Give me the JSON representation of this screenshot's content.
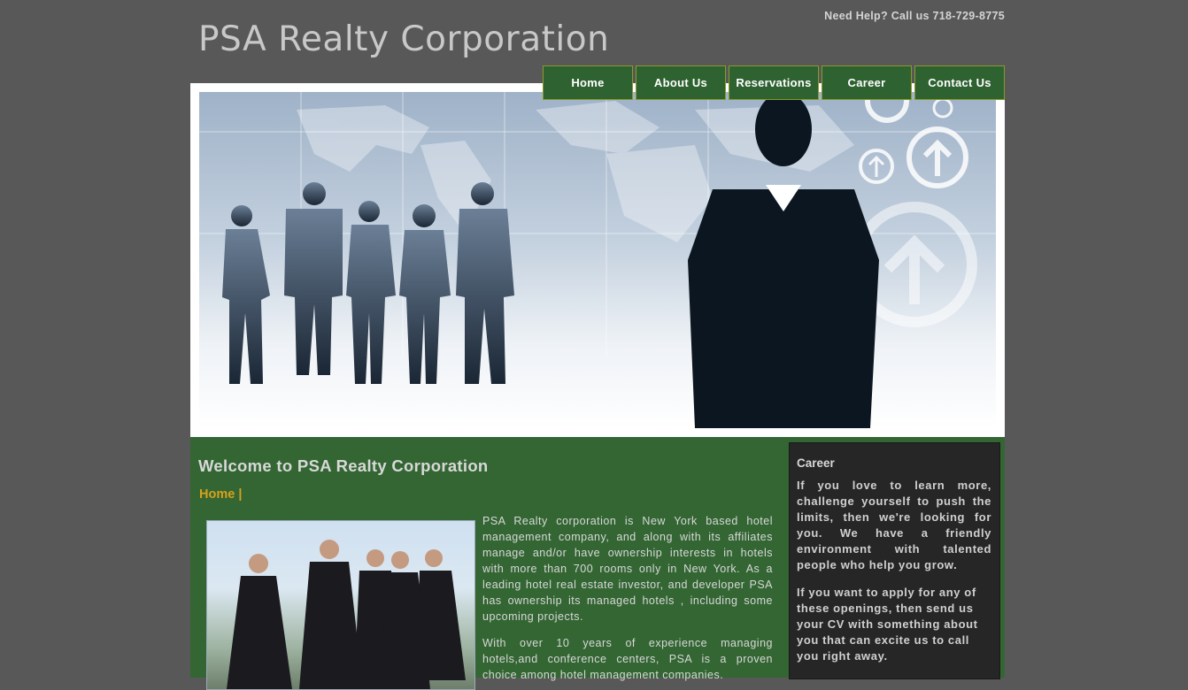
{
  "header": {
    "site_title": "PSA Realty Corporation",
    "help_text": "Need Help? Call us 718-729-8775"
  },
  "nav": {
    "items": [
      {
        "label": "Home"
      },
      {
        "label": "About Us"
      },
      {
        "label": "Reservations"
      },
      {
        "label": "Career"
      },
      {
        "label": "Contact Us"
      }
    ]
  },
  "main": {
    "heading": "Welcome to PSA Realty Corporation",
    "breadcrumb": "Home |",
    "paragraphs": [
      "PSA Realty corporation is New York based hotel management company, and along with its affiliates manage and/or have ownership interests in hotels with more than 700 rooms only in New York. As a leading hotel real estate investor, and developer PSA has ownership its managed hotels , including some upcoming projects.",
      "With over 10 years of experience managing hotels,and conference centers, PSA is a proven choice among hotel management companies."
    ]
  },
  "sidebar": {
    "title": "Career",
    "paragraphs": [
      "If you love to learn more, challenge yourself to push the limits, then we're looking for you. We have a friendly environment with talented people who help you grow.",
      "If you want to apply for any of these openings, then send us your CV with something about you that can excite us to call you right away."
    ]
  },
  "colors": {
    "page_bg": "#585858",
    "nav_bg": "#2f6231",
    "content_bg": "#336633",
    "sidebar_bg": "#262626",
    "accent": "#d8a01a"
  }
}
